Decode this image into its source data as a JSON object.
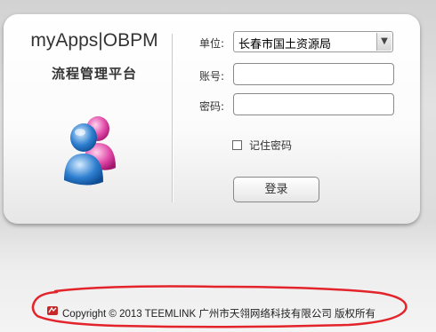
{
  "brand": {
    "title": "myApps|OBPM",
    "subtitle": "流程管理平台"
  },
  "form": {
    "unit_label": "单位:",
    "unit_value": "长春市国土资源局",
    "account_label": "账号:",
    "account_value": "",
    "password_label": "密码:",
    "password_value": "",
    "remember_label": "记住密码",
    "login_label": "登录"
  },
  "footer": {
    "copyright": "Copyright © 2013 TEEMLINK 广州市天翎网络科技有限公司  版权所有"
  },
  "icons": {
    "avatar": "users-icon",
    "dropdown": "chevron-down-icon",
    "footer": "company-logo-icon"
  },
  "colors": {
    "highlight_ellipse": "#e3242b",
    "avatar_blue": "#2e7fd0",
    "avatar_pink": "#e04aa8"
  }
}
